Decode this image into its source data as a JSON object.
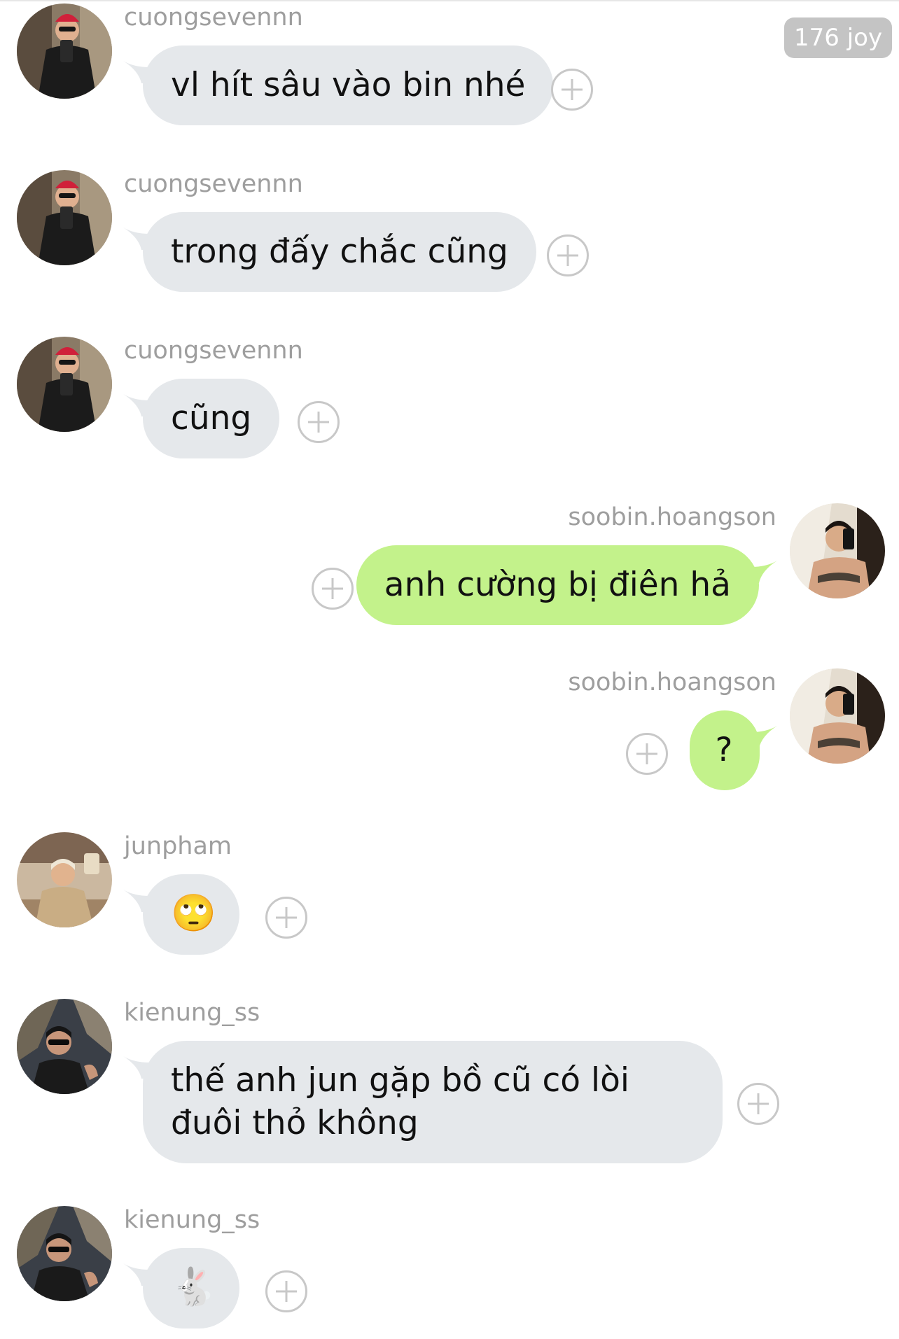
{
  "reaction_count": "176 joy",
  "messages": [
    {
      "sender": "cuongsevennn",
      "text": "vl hít sâu vào bin nhé",
      "direction": "incoming",
      "avatar": "avatar-cuongsevennn"
    },
    {
      "sender": "cuongsevennn",
      "text": "trong đấy chắc cũng",
      "direction": "incoming",
      "avatar": "avatar-cuongsevennn"
    },
    {
      "sender": "cuongsevennn",
      "text": "cũng",
      "direction": "incoming",
      "avatar": "avatar-cuongsevennn"
    },
    {
      "sender": "soobin.hoangson",
      "text": "anh cường bị điên hả",
      "direction": "outgoing",
      "avatar": "avatar-soobin"
    },
    {
      "sender": "soobin.hoangson",
      "text": "?",
      "direction": "outgoing",
      "avatar": "avatar-soobin"
    },
    {
      "sender": "junpham",
      "text": "🙄",
      "direction": "incoming",
      "avatar": "avatar-junpham"
    },
    {
      "sender": "kienung_ss",
      "text": "thế anh jun gặp bồ cũ có lòi đuôi thỏ không",
      "direction": "incoming",
      "avatar": "avatar-kienung"
    },
    {
      "sender": "kienung_ss",
      "text": "🐇",
      "direction": "incoming",
      "avatar": "avatar-kienung"
    }
  ],
  "icons": {
    "add_reaction": "plus-circle-icon"
  },
  "colors": {
    "incoming_bubble": "#e5e8eb",
    "outgoing_bubble": "#c3f28b",
    "sender_text": "#9e9e9e",
    "badge_bg": "#c4c4c4"
  }
}
